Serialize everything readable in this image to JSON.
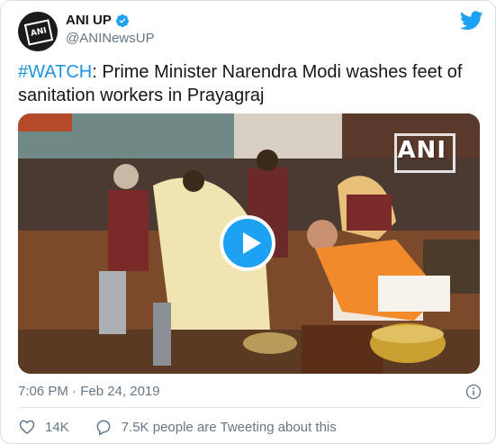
{
  "author": {
    "display_name": "ANI UP",
    "handle": "@ANINewsUP",
    "avatar_text": "ANI"
  },
  "tweet": {
    "hashtag": "#WATCH",
    "text": ": Prime Minister Narendra Modi washes feet of sanitation workers in Prayagraj"
  },
  "media": {
    "watermark": "ANI",
    "play_icon": "play-icon"
  },
  "meta": {
    "timestamp": "7:06 PM · Feb 24, 2019"
  },
  "actions": {
    "likes": "14K",
    "conversation": "7.5K people are Tweeting about this"
  },
  "colors": {
    "accent": "#1da1f2",
    "hashtag": "#1b95e0",
    "muted": "#657786",
    "text": "#14171a"
  }
}
